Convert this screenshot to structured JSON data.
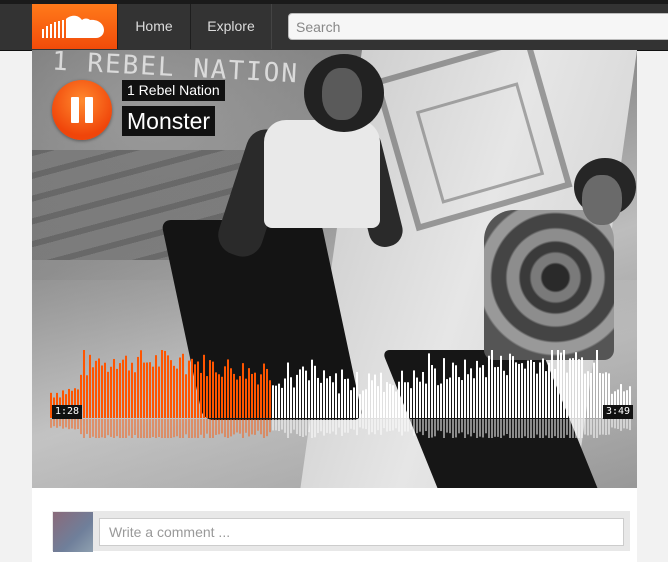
{
  "header": {
    "logo": "soundcloud-logo",
    "nav": [
      {
        "label": "Home"
      },
      {
        "label": "Explore"
      }
    ],
    "search_placeholder": "Search"
  },
  "player": {
    "artist": "1 Rebel Nation",
    "title": "Monster",
    "artwork_text": "1 REBEL NATION",
    "state": "playing",
    "elapsed": "1:28",
    "duration": "3:49",
    "progress": 0.384,
    "played_color": "#ff5500",
    "unplayed_color": "#ffffff"
  },
  "comment": {
    "placeholder": "Write a comment ..."
  },
  "colors": {
    "brand": "#ff5500",
    "topbar": "#333333"
  }
}
